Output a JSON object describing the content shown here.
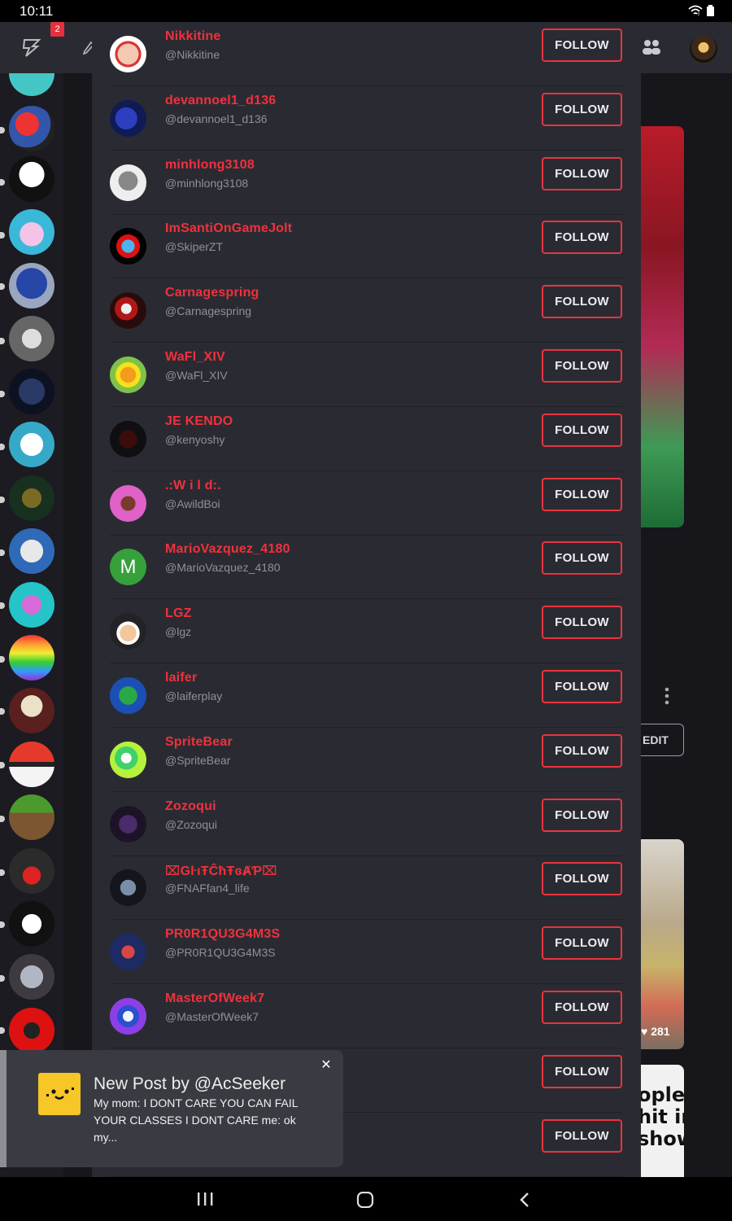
{
  "status": {
    "time": "10:11"
  },
  "topbar": {
    "notification_count": "2"
  },
  "background": {
    "edit_label": "EDIT",
    "like_count": "281",
    "card_text": "ople\nhit in\nshow"
  },
  "colors": {
    "accent": "#e8343f",
    "name_red": "#f0313d",
    "modal_bg": "#2a2b32",
    "toast_icon": "#f7c627"
  },
  "follow_label": "FOLLOW",
  "users": [
    {
      "name": "Nikkitine",
      "handle": "@Nikkitine",
      "avatar": "cartoon-face-avatar"
    },
    {
      "name": "devannoel1_d136",
      "handle": "@devannoel1_d136",
      "avatar": "pony-avatar"
    },
    {
      "name": "minhlong3108",
      "handle": "@minhlong3108",
      "avatar": "robot-avatar"
    },
    {
      "name": "ImSantiOnGameJolt",
      "handle": "@SkiperZT",
      "avatar": "blue-ring-avatar"
    },
    {
      "name": "Carnagespring",
      "handle": "@Carnagespring",
      "avatar": "carnage-avatar"
    },
    {
      "name": "WaFl_XIV",
      "handle": "@WaFl_XIV",
      "avatar": "sunflower-avatar"
    },
    {
      "name": "JE KENDO",
      "handle": "@kenyoshy",
      "avatar": "dark-character-avatar"
    },
    {
      "name": ".:W i l d:.",
      "handle": "@AwildBoi",
      "avatar": "pink-character-avatar"
    },
    {
      "name": "MarioVazquez_4180",
      "handle": "@MarioVazquez_4180",
      "avatar": "letter-avatar",
      "letter": "M"
    },
    {
      "name": "LGZ",
      "handle": "@lgz",
      "avatar": "luigi-avatar"
    },
    {
      "name": "laifer",
      "handle": "@laiferplay",
      "avatar": "green-hedgehog-avatar"
    },
    {
      "name": "SpriteBear",
      "handle": "@SpriteBear",
      "avatar": "green-sprite-avatar"
    },
    {
      "name": "Zozoqui",
      "handle": "@Zozoqui",
      "avatar": "purple-shadow-avatar"
    },
    {
      "name": "⌧GŀıŦĈħŦɞȺƤ⌧",
      "handle": "@FNAFfan4_life",
      "avatar": "animatronic-avatar"
    },
    {
      "name": "PR0R1QU3G4M3S",
      "handle": "@PR0R1QU3G4M3S",
      "avatar": "blocky-character-avatar"
    },
    {
      "name": "MasterOfWeek7",
      "handle": "@MasterOfWeek7",
      "avatar": "blue-glitch-avatar"
    },
    {
      "name": "",
      "handle": "",
      "avatar": "hidden-avatar"
    },
    {
      "name": "",
      "handle": "",
      "avatar": "hidden-avatar"
    }
  ],
  "toast": {
    "title": "New Post by @AcSeeker",
    "body": "My mom: I DONT CARE YOU CAN FAIL YOUR CLASSES I DONT CARE me: ok my..."
  }
}
